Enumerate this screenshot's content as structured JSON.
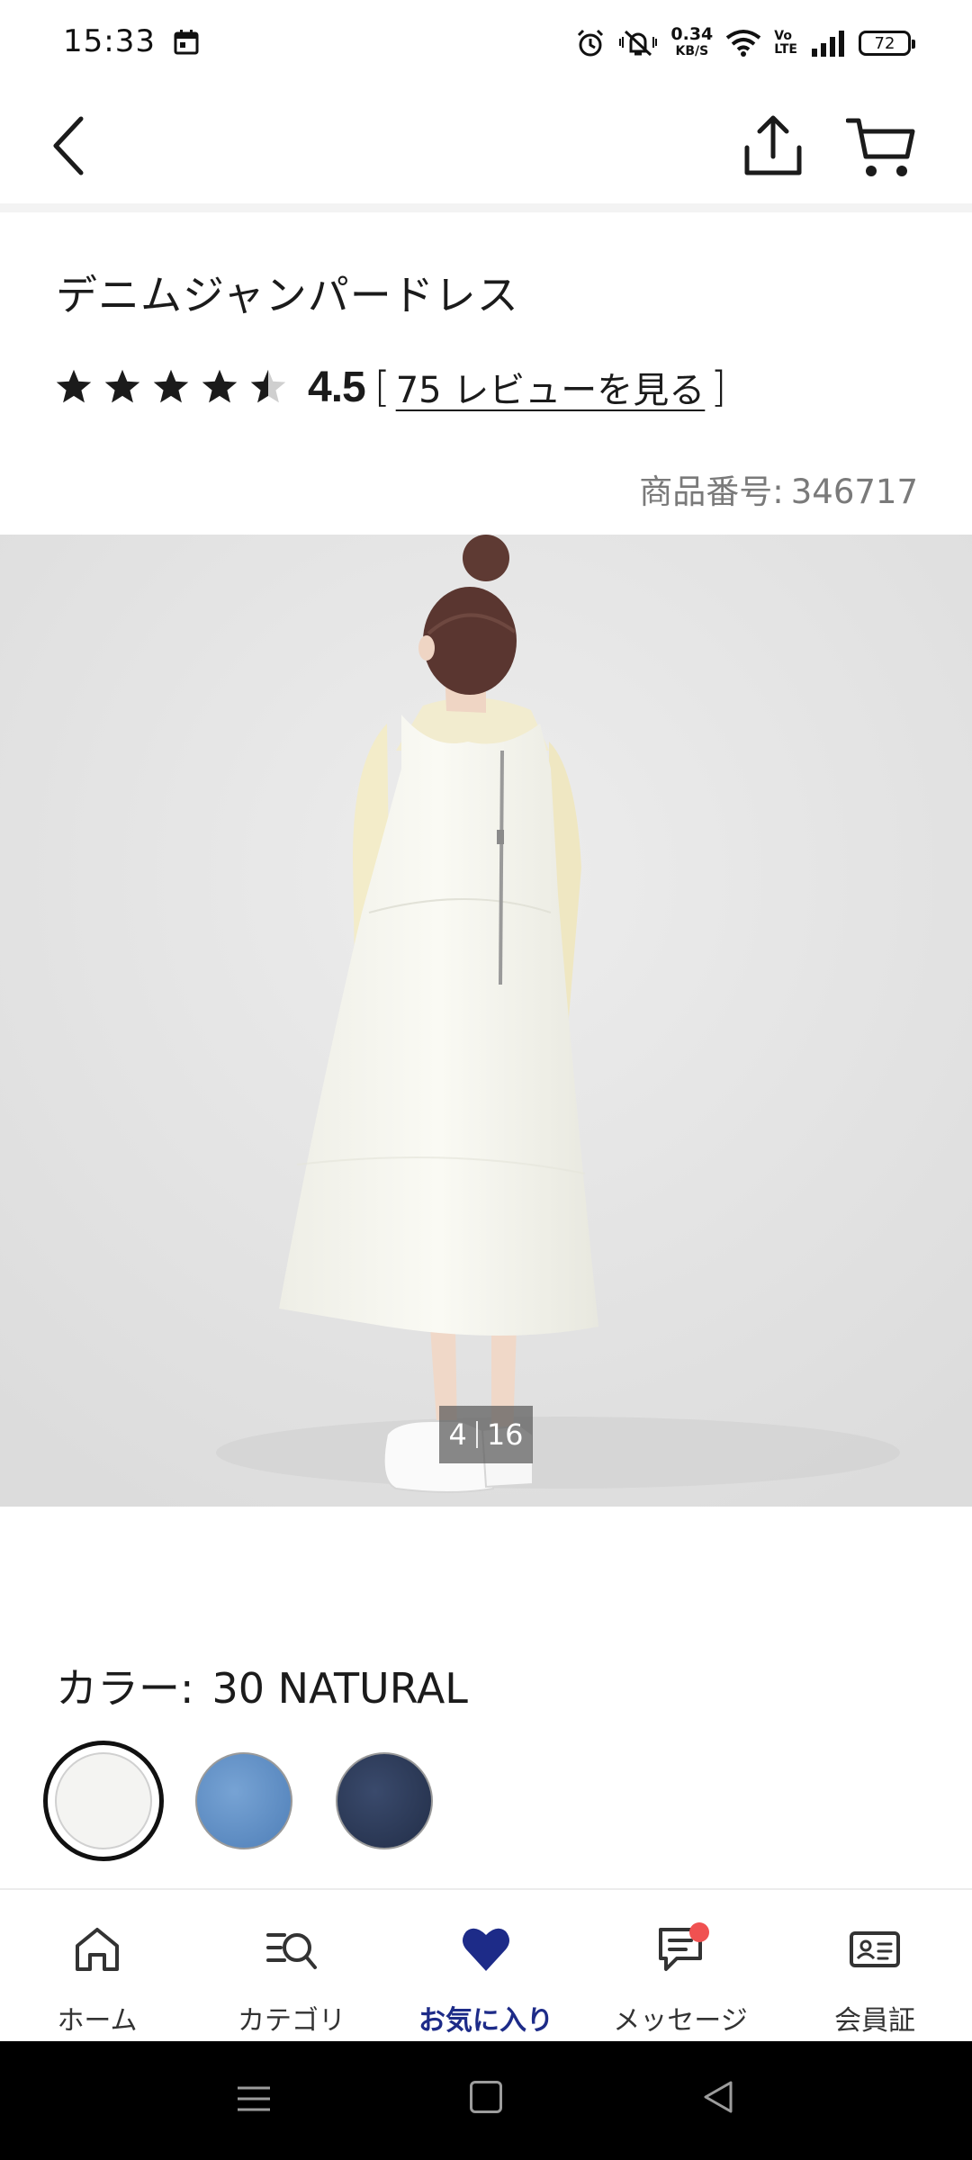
{
  "status_bar": {
    "time": "15:33",
    "net_speed": "0.34",
    "net_unit": "KB/S",
    "volte_top": "Vo",
    "volte_bottom": "LTE",
    "battery": "72"
  },
  "header": {
    "back_icon": "chevron-left-icon",
    "share_icon": "share-icon",
    "cart_icon": "cart-icon"
  },
  "product": {
    "title": "デニムジャンパードレス",
    "rating": "4.5",
    "rating_stars": 4.5,
    "bracket_open": "[",
    "review_link": "75 レビューを見る",
    "bracket_close": "]",
    "number_label": "商品番号:",
    "number": "346717"
  },
  "gallery": {
    "current": "4",
    "total": "16"
  },
  "color": {
    "label": "カラー:",
    "value": "30 NATURAL",
    "swatches": [
      {
        "name": "natural",
        "color": "#f4f4f2",
        "selected": true
      },
      {
        "name": "blue",
        "color": "#5f8fc6",
        "selected": false
      },
      {
        "name": "navy",
        "color": "#2c3a58",
        "selected": false
      }
    ]
  },
  "bottom_nav": {
    "items": [
      {
        "label": "ホーム",
        "icon": "home-icon"
      },
      {
        "label": "カテゴリ",
        "icon": "category-search-icon"
      },
      {
        "label": "お気に入り",
        "icon": "heart-icon",
        "active": true
      },
      {
        "label": "メッセージ",
        "icon": "message-icon",
        "badge": true
      },
      {
        "label": "会員証",
        "icon": "member-card-icon"
      }
    ]
  },
  "colors": {
    "accent": "#1d2b88",
    "badge": "#f05151",
    "image_bg": "#e6e6e6"
  }
}
